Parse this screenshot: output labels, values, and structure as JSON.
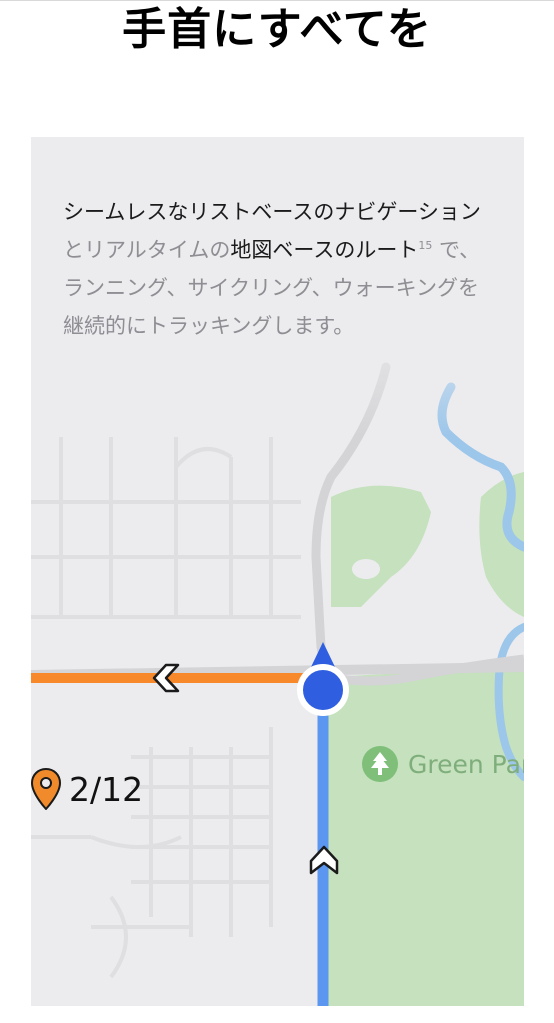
{
  "headline": "手首にすべてを",
  "description": {
    "segments": [
      {
        "text": "シームレスなリストベースのナビゲーション",
        "highlight": true
      },
      {
        "text": "と",
        "highlight": false
      },
      {
        "text": "リアルタイムの",
        "highlight": false
      },
      {
        "text": "地図ベースのルート",
        "highlight": true
      },
      {
        "text": "15",
        "superscript": true
      },
      {
        "text": " で、ランニング、サイクリング、ウォーキングを継続的にトラッキングします。",
        "highlight": false
      }
    ]
  },
  "map": {
    "route_counter": "2/12",
    "park_name": "Green Park",
    "colors": {
      "map_background": "#ececef",
      "park": "#c5e1bd",
      "water": "#9cc6ea",
      "road": "#d4d4d7",
      "minor_road": "#dfdfe2",
      "route_orange": "#f7892a",
      "route_blue": "#5b96f0",
      "location_dot": "#2f5fe0",
      "heading_arrow": "#2f5fe0",
      "pin": "#f08a2a"
    },
    "icons": {
      "pin": "map-pin-icon",
      "tree": "tree-icon",
      "chevron": "chevron-left-icon",
      "direction": "direction-arrow-icon",
      "location": "current-location-icon"
    }
  }
}
